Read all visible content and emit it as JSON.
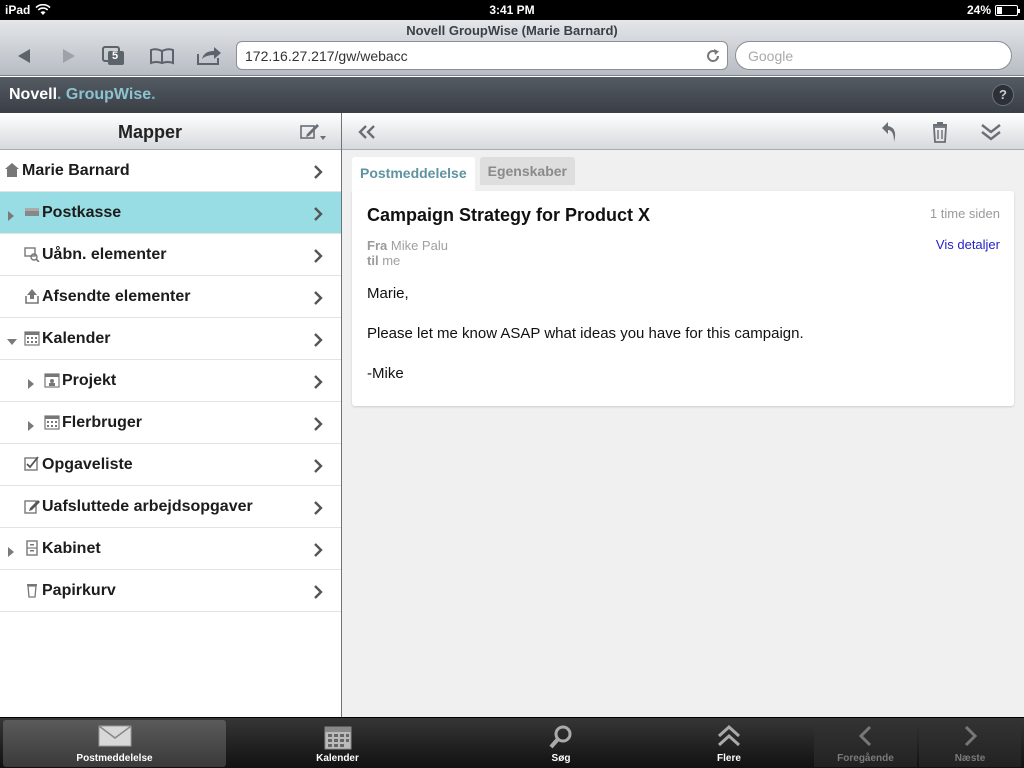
{
  "status_bar": {
    "device": "iPad",
    "time": "3:41 PM",
    "battery": "24%",
    "battery_level": 0.24
  },
  "browser": {
    "title": "Novell GroupWise (Marie Barnard)",
    "tab_count": "5",
    "url": "172.16.27.217/gw/webacc",
    "search_placeholder": "Google"
  },
  "app_header": {
    "brand_novell": "Novell",
    "brand_dot1": ".",
    "brand_groupwise": "GroupWise",
    "brand_dot2": ".",
    "help": "?"
  },
  "sidebar": {
    "title": "Mapper",
    "folders": [
      {
        "label": "Marie Barnard",
        "icon": "home-icon",
        "indent": 0,
        "expander": "none"
      },
      {
        "label": "Postkasse",
        "icon": "mailbox-icon",
        "indent": 1,
        "expander": "collapsed",
        "selected": true
      },
      {
        "label": "Uåbn. elementer",
        "icon": "unopened-icon",
        "indent": 1,
        "expander": "none"
      },
      {
        "label": "Afsendte elementer",
        "icon": "sent-icon",
        "indent": 1,
        "expander": "none"
      },
      {
        "label": "Kalender",
        "icon": "calendar-icon",
        "indent": 1,
        "expander": "expanded"
      },
      {
        "label": "Projekt",
        "icon": "project-icon",
        "indent": 2,
        "expander": "collapsed"
      },
      {
        "label": "Flerbruger",
        "icon": "calendar-icon",
        "indent": 2,
        "expander": "collapsed"
      },
      {
        "label": "Opgaveliste",
        "icon": "checklist-icon",
        "indent": 1,
        "expander": "none"
      },
      {
        "label": "Uafsluttede arbejdsopgaver",
        "icon": "work-in-progress-icon",
        "indent": 1,
        "expander": "none"
      },
      {
        "label": "Kabinet",
        "icon": "cabinet-icon",
        "indent": 1,
        "expander": "collapsed"
      },
      {
        "label": "Papirkurv",
        "icon": "trash-icon",
        "indent": 1,
        "expander": "none"
      }
    ]
  },
  "message": {
    "tabs": [
      {
        "label": "Postmeddelelse",
        "active": true
      },
      {
        "label": "Egenskaber",
        "active": false
      }
    ],
    "subject": "Campaign Strategy for Product X",
    "time": "1 time siden",
    "from_label": "Fra",
    "from": "Mike Palu",
    "to_label": "til",
    "to": "me",
    "details_link": "Vis detaljer",
    "body": [
      "Marie,",
      "Please let me know ASAP what ideas you have for this campaign.",
      "-Mike"
    ]
  },
  "tabbar": [
    {
      "label": "Postmeddelelse",
      "icon": "envelope-icon",
      "active": true
    },
    {
      "label": "Kalender",
      "icon": "calendar-icon"
    },
    {
      "label": "Søg",
      "icon": "search-icon"
    },
    {
      "label": "Flere",
      "icon": "more-icon"
    },
    {
      "label": "Foregående",
      "icon": "chevron-left-icon",
      "disabled": true
    },
    {
      "label": "Næste",
      "icon": "chevron-right-icon",
      "disabled": true
    }
  ]
}
